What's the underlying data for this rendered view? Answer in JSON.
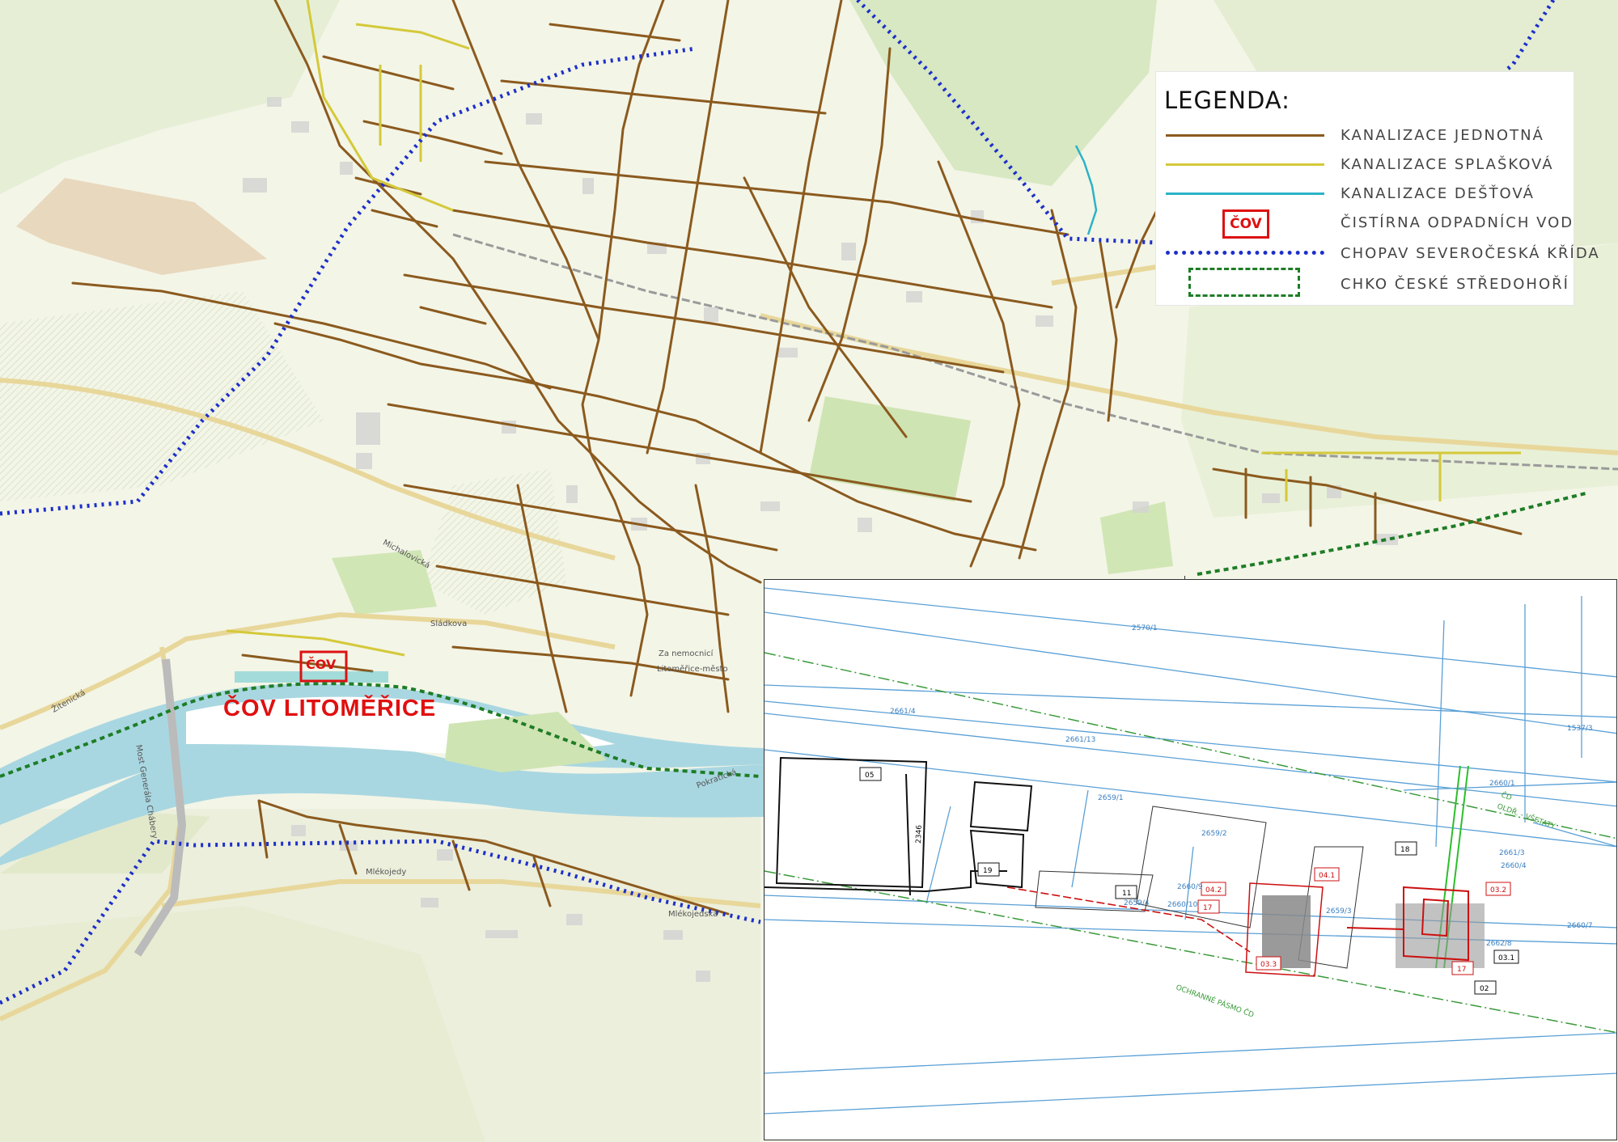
{
  "legend": {
    "title": "LEGENDA:",
    "items": [
      {
        "label": "KANALIZACE JEDNOTNÁ",
        "symbol": "line-brown",
        "color": "#8b5a1e"
      },
      {
        "label": "KANALIZACE SPLAŠKOVÁ",
        "symbol": "line-yellow",
        "color": "#d4c93a"
      },
      {
        "label": "KANALIZACE DEŠŤOVÁ",
        "symbol": "line-cyan",
        "color": "#2bb3c7"
      },
      {
        "label": "ČISTÍRNA ODPADNÍCH VOD",
        "symbol": "cov-box",
        "color": "#d11111",
        "symbol_text": "ČOV"
      },
      {
        "label": "CHOPAV SEVEROČESKÁ KŘÍDA",
        "symbol": "dotted-blue",
        "color": "#1d2fc9"
      },
      {
        "label": "CHKO ČESKÉ STŘEDOHOŘÍ",
        "symbol": "dashed-green-box",
        "color": "#1e7d26"
      }
    ]
  },
  "map_labels": {
    "cov_title": "ČOV LITOMĚŘICE",
    "cov_marker": "ČOV",
    "streets": [
      "Za nemocnicí",
      "Litoměřice-město",
      "Mlékojedy",
      "Mlékojedská",
      "Michalovická",
      "Sládkova",
      "Pokratická",
      "Žitenická",
      "Most Generála Chábery"
    ]
  },
  "plan": {
    "objects": [
      "05",
      "19",
      "11",
      "04.2",
      "04.1",
      "18",
      "03.2",
      "17",
      "17",
      "03.3",
      "03.1",
      "02"
    ],
    "parcels": [
      "2570/1",
      "2661/4",
      "2661/13",
      "2659/1",
      "2659/2",
      "2659/3",
      "2660/9",
      "2660/10",
      "2659/4",
      "2660/4",
      "2661/3",
      "2660/7",
      "2662/8",
      "1537/3",
      "2660/1"
    ],
    "annotations": [
      "OCHRANNÉ PÁSMO ČD",
      "ČD",
      "OLDŘ. - VŠETATY",
      "2346"
    ]
  },
  "colors": {
    "combined_sewer": "#8b5a1e",
    "sanitary_sewer": "#d4c93a",
    "storm_sewer": "#2bb3c7",
    "wwtp": "#d11111",
    "chopav": "#1d2fc9",
    "chko": "#1e7d26",
    "river": "#a9d7e1",
    "forest": "#cfe4b3",
    "plan_lines": "#5aa0d6"
  }
}
